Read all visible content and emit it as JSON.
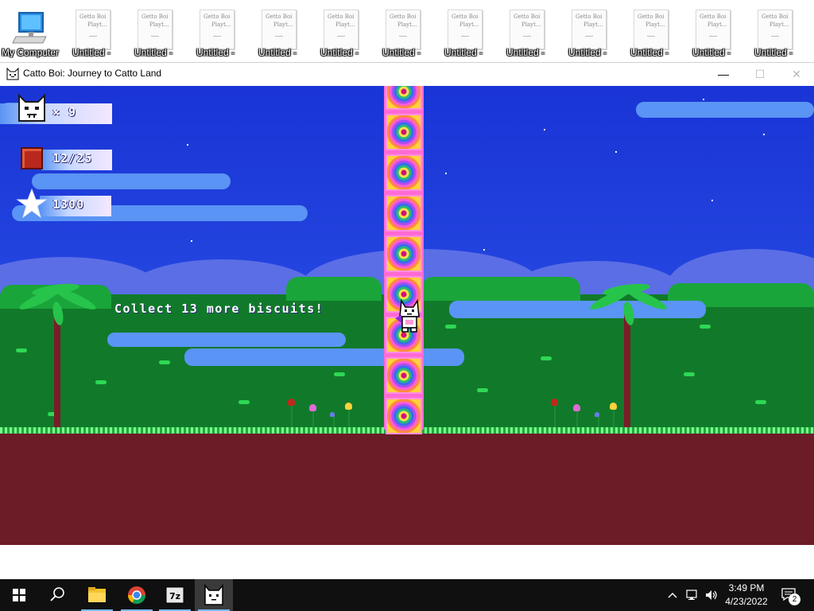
{
  "desktop": {
    "icons": [
      {
        "label": "My Computer",
        "type": "computer"
      },
      {
        "label": "Untitled - ",
        "scribble1": "Getto Boi",
        "scribble2": "Playt..."
      },
      {
        "label": "Untitled - ",
        "scribble1": "Getto Boi",
        "scribble2": "Playt..."
      },
      {
        "label": "Untitled - ",
        "scribble1": "Getto Boi",
        "scribble2": "Playt..."
      },
      {
        "label": "Untitled - ",
        "scribble1": "Getto Boi",
        "scribble2": "Playt..."
      },
      {
        "label": "Untitled - ",
        "scribble1": "Getto Boi",
        "scribble2": "Playt..."
      },
      {
        "label": "Untitled - ",
        "scribble1": "Getto Boi",
        "scribble2": "Playt..."
      },
      {
        "label": "Untitled - ",
        "scribble1": "Getto Boi",
        "scribble2": "Playt..."
      },
      {
        "label": "Untitled - ",
        "scribble1": "Getto Boi",
        "scribble2": "Playt..."
      },
      {
        "label": "Untitled - ",
        "scribble1": "Getto Boi",
        "scribble2": "Playt..."
      },
      {
        "label": "Untitled - ",
        "scribble1": "Getto Boi",
        "scribble2": "Playt..."
      },
      {
        "label": "Untitled - ",
        "scribble1": "Getto Boi",
        "scribble2": "Playt..."
      },
      {
        "label": "Untitled - ",
        "scribble1": "Getto Boi",
        "scribble2": "Playt..."
      }
    ]
  },
  "window": {
    "title": "Catto Boi: Journey to Catto Land",
    "minimize_glyph": "—",
    "maximize_glyph": "☐",
    "close_glyph": "✕"
  },
  "hud": {
    "lives": "× 9",
    "biscuits": "12/25",
    "score": "1300"
  },
  "game": {
    "message": "Collect 13 more biscuits!"
  },
  "colors": {
    "sky": "#2446e0",
    "ground": "#6b1c27",
    "forest": "#117a2a",
    "tower_pink": "#ff6ad5",
    "taskbar": "#101010"
  },
  "taskbar": {
    "apps": [
      {
        "name": "start-button",
        "icon": "windows-logo"
      },
      {
        "name": "search-button",
        "icon": "search-icon"
      },
      {
        "name": "file-explorer",
        "icon": "folder-icon"
      },
      {
        "name": "chrome",
        "icon": "chrome-icon"
      },
      {
        "name": "7zip",
        "icon": "7z-icon",
        "label": "7z"
      },
      {
        "name": "catto-boi",
        "icon": "cat-icon"
      }
    ],
    "time": "3:49 PM",
    "date": "4/23/2022",
    "notification_count": "2"
  }
}
